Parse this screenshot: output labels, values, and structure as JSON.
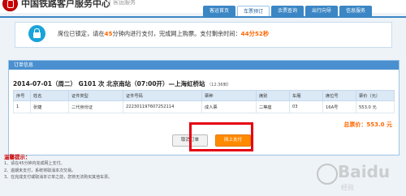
{
  "header": {
    "title": "中国铁路客户服务中心",
    "subtitle": "客运服务",
    "nav": [
      "客运首页",
      "车票预订",
      "余票查询",
      "出行向导",
      "信息服务"
    ],
    "active_nav": "车票预订"
  },
  "notice": {
    "icon": "lock-icon",
    "text_part1": "席位已锁定，请在",
    "minutes": "45",
    "text_part2": "分钟内进行支付，完成网上购票。支付剩余时间：",
    "countdown": "44分52秒"
  },
  "order": {
    "panel_title": "订单信息",
    "date": "2014-07-01（周二）",
    "train_no": "G101 次",
    "from_station": "北京南站（07:00开）",
    "to_station": "—上海虹桥站",
    "arrive": "（12:36到）",
    "columns": [
      "序号",
      "姓名",
      "证件类型",
      "证件号码",
      "票种",
      "席别",
      "车厢",
      "席位号",
      "票价（元）"
    ],
    "rows": [
      [
        "1",
        "张婕",
        "二代身份证",
        "222301197607252114",
        "成人票",
        "二等座",
        "03",
        "16A号",
        "553.0 元"
      ]
    ],
    "total_label": "总票价：",
    "total_value": "553.0 元",
    "cancel_label": "取消订单",
    "pay_label": "网上支付"
  },
  "tips": {
    "title": "温馨提示：",
    "items": [
      "1、请在45分钟内完成网上支付。",
      "2、逾期未支付，系统将取消本次交易。",
      "3、在完成支付或取消本订单之前，您将无法购买其他车票。"
    ]
  },
  "watermark": {
    "brand": "Baidu",
    "sub": "经验"
  }
}
